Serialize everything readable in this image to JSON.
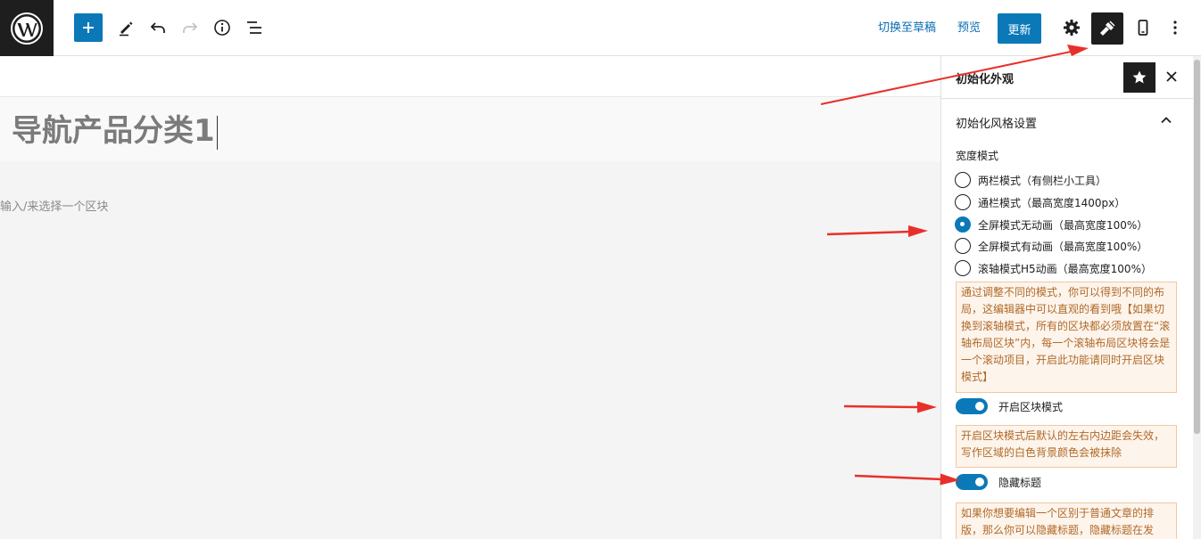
{
  "toolbar": {
    "switch_to_draft": "切换至草稿",
    "preview": "预览",
    "update": "更新",
    "icons": [
      "wordpress-logo-icon",
      "plus-icon",
      "pencil-icon",
      "undo-icon",
      "redo-icon",
      "info-icon",
      "list-view-icon",
      "gear-icon",
      "brush-icon",
      "mobile-icon",
      "more-vertical-icon"
    ]
  },
  "editor": {
    "post_title": "导航产品分类1",
    "block_placeholder": "输入/来选择一个区块"
  },
  "sidebar": {
    "title": "初始化外观",
    "panel_title": "初始化风格设置",
    "width_mode_label": "宽度模式",
    "radio_options": [
      {
        "label": "两栏模式（有侧栏小工具）",
        "checked": false
      },
      {
        "label": "通栏模式（最高宽度1400px）",
        "checked": false
      },
      {
        "label": "全屏模式无动画（最高宽度100%）",
        "checked": true
      },
      {
        "label": "全屏模式有动画（最高宽度100%）",
        "checked": false
      },
      {
        "label": "滚轴模式H5动画（最高宽度100%）",
        "checked": false
      }
    ],
    "notice1": "通过调整不同的模式，你可以得到不同的布局，这编辑器中可以直观的看到哦【如果切换到滚轴模式，所有的区块都必须放置在“滚轴布局区块”内，每一个滚轴布局区块将会是一个滚动项目，开启此功能请同时开启区块模式】",
    "toggle1_label": "开启区块模式",
    "toggle1_on": true,
    "notice2": "开启区块模式后默认的左右内边距会失效，写作区域的白色背景颜色会被抹除",
    "toggle2_label": "隐藏标题",
    "toggle2_on": true,
    "notice3": "如果你想要编辑一个区别于普通文章的排版，那么你可以隐藏标题，隐藏标题在发"
  },
  "colors": {
    "accent": "#0b79b8",
    "annotation_arrow": "#e8302a",
    "notice_text": "#b06a28",
    "notice_bg": "#fdf4ec"
  }
}
